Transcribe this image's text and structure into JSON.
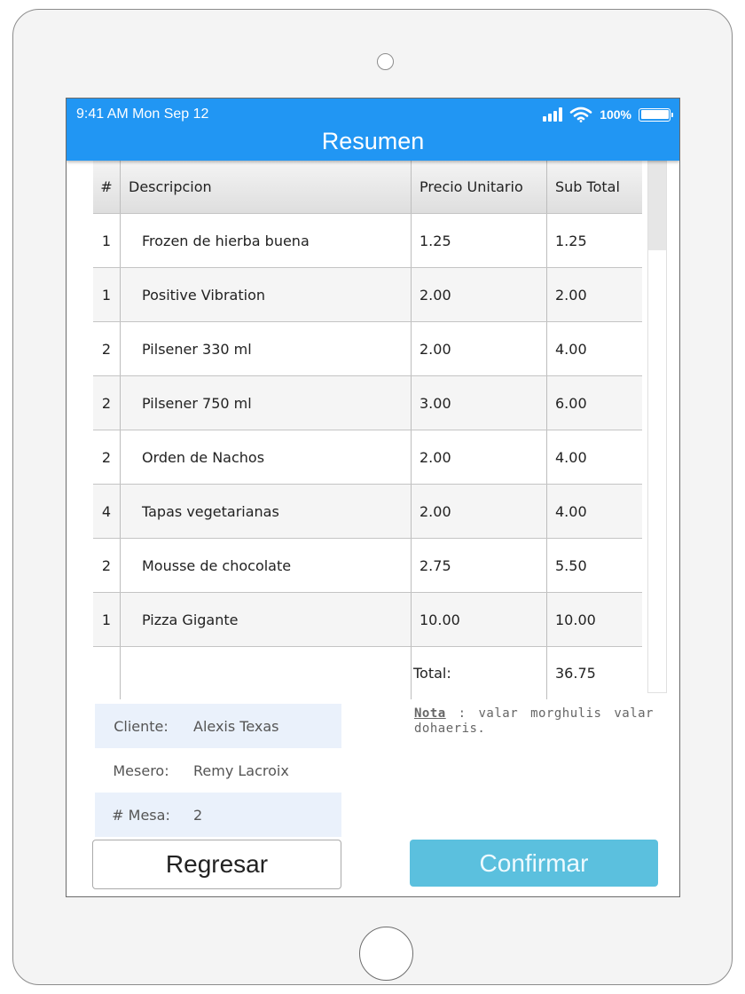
{
  "status_bar": {
    "time": "9:41 AM  Mon Sep 12",
    "battery": "100%"
  },
  "header": {
    "title": "Resumen"
  },
  "table": {
    "columns": [
      "#",
      "Descripcion",
      "Precio Unitario",
      "Sub Total"
    ],
    "rows": [
      {
        "qty": "1",
        "desc": "Frozen de hierba buena",
        "price": "1.25",
        "subtotal": "1.25"
      },
      {
        "qty": "1",
        "desc": "Positive Vibration",
        "price": "2.00",
        "subtotal": "2.00"
      },
      {
        "qty": "2",
        "desc": "Pilsener 330 ml",
        "price": "2.00",
        "subtotal": "4.00"
      },
      {
        "qty": "2",
        "desc": "Pilsener 750 ml",
        "price": "3.00",
        "subtotal": "6.00"
      },
      {
        "qty": "2",
        "desc": "Orden de Nachos",
        "price": "2.00",
        "subtotal": "4.00"
      },
      {
        "qty": "4",
        "desc": "Tapas vegetarianas",
        "price": "2.00",
        "subtotal": "4.00"
      },
      {
        "qty": "2",
        "desc": "Mousse de chocolate",
        "price": "2.75",
        "subtotal": "5.50"
      },
      {
        "qty": "1",
        "desc": "Pizza Gigante",
        "price": "10.00",
        "subtotal": "10.00"
      }
    ],
    "total_label": "Total:",
    "total_value": "36.75"
  },
  "info": {
    "client_label": "Cliente:",
    "client_value": "Alexis Texas",
    "waiter_label": "Mesero:",
    "waiter_value": "Remy Lacroix",
    "table_label": "# Mesa:",
    "table_value": "2"
  },
  "note": {
    "label": "Nota",
    "separator": " : ",
    "text": "valar morghulis valar dohaeris."
  },
  "buttons": {
    "back": "Regresar",
    "confirm": "Confirmar"
  },
  "colors": {
    "header": "#2196f3",
    "confirm": "#5bc0de",
    "info_shade": "#eaf1fb"
  }
}
